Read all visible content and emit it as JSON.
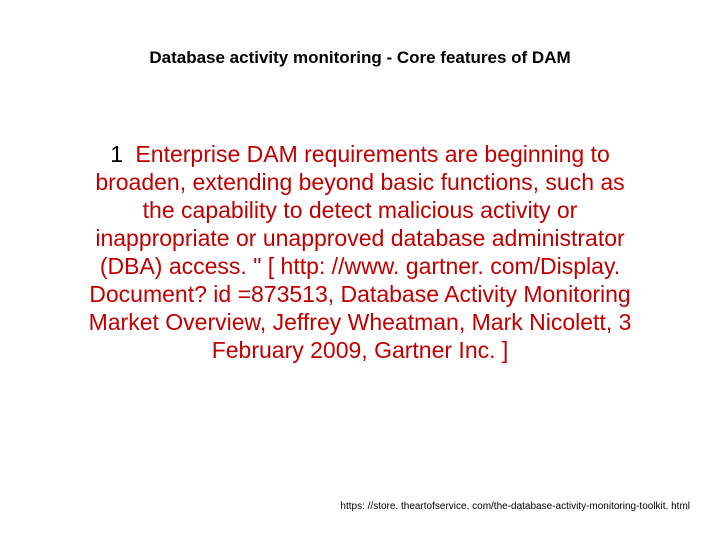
{
  "title": "Database activity monitoring -  Core features of DAM",
  "body": " Enterprise DAM requirements are beginning to broaden, extending beyond basic functions, such as the capability to detect malicious activity or inappropriate or unapproved database administrator (DBA) access. \" [ http: //www. gartner. com/Display. Document? id =873513, Database Activity Monitoring Market Overview, Jeffrey Wheatman, Mark Nicolett, 3 February 2009, Gartner Inc. ]",
  "footer": "https: //store. theartofservice. com/the-database-activity-monitoring-toolkit. html"
}
